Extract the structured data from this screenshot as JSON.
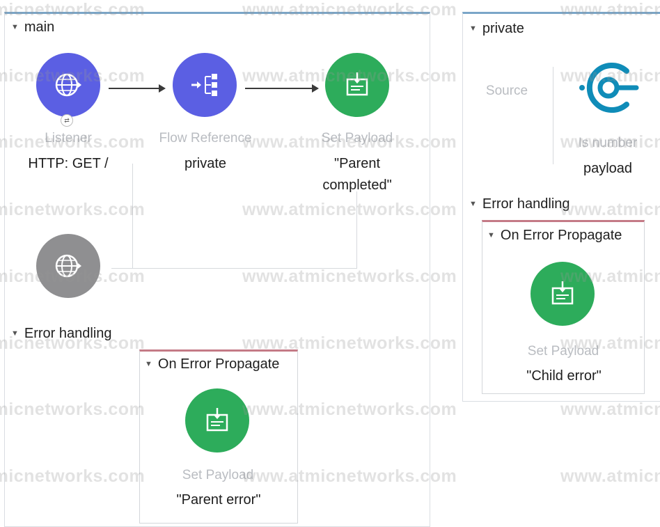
{
  "watermark": "www.atmicnetworks.com",
  "main_flow": {
    "title": "main",
    "listener": {
      "type": "Listener",
      "config": "HTTP: GET /"
    },
    "flow_reference": {
      "type": "Flow Reference",
      "config": "private"
    },
    "set_payload": {
      "type": "Set Payload",
      "value_line1": "\"Parent",
      "value_line2": "completed\""
    },
    "error_handling": {
      "title": "Error handling",
      "on_error": {
        "title": "On Error Propagate",
        "set_payload": {
          "type": "Set Payload",
          "value": "\"Parent error\""
        }
      }
    }
  },
  "private_flow": {
    "title": "private",
    "source_label": "Source",
    "validator": {
      "type": "Is number",
      "config": "payload"
    },
    "error_handling": {
      "title": "Error handling",
      "on_error": {
        "title": "On Error Propagate",
        "set_payload": {
          "type": "Set Payload",
          "value": "\"Child error\""
        }
      }
    }
  },
  "colors": {
    "connector": "#5b5fe3",
    "transformer": "#2dac5b",
    "source_disabled": "#8f8f91",
    "validation": "#0f8cb8",
    "error_accent": "#c47a86"
  }
}
